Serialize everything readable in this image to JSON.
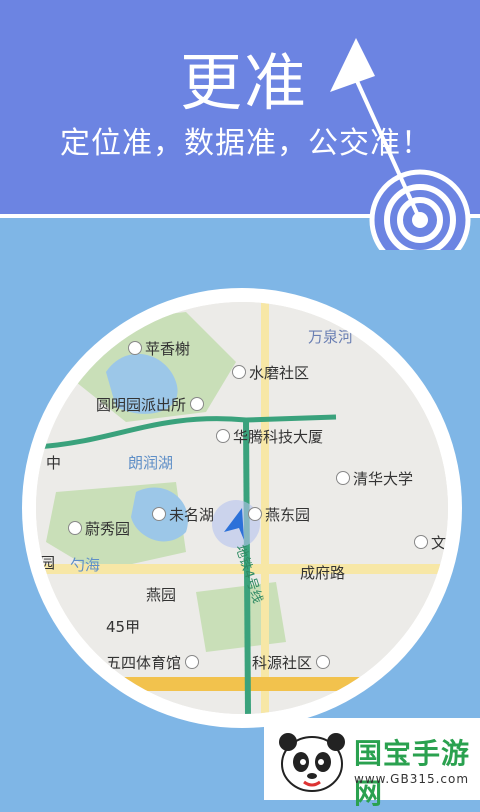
{
  "header": {
    "headline": "更准",
    "subline": "定位准，数据准，公交准！",
    "bg_color": "#6c84e2"
  },
  "main": {
    "bg_color": "#7fb6e6",
    "map": {
      "pois": [
        {
          "label": "苹香榭",
          "icon": "building-icon"
        },
        {
          "label": "万泉河",
          "icon": ""
        },
        {
          "label": "水磨社区",
          "icon": "building-icon"
        },
        {
          "label": "圆明园派出所",
          "icon": "police-icon"
        },
        {
          "label": "华腾科技大厦",
          "icon": "building-icon"
        },
        {
          "label": "中",
          "icon": ""
        },
        {
          "label": "朗润湖",
          "icon": ""
        },
        {
          "label": "清华大学",
          "icon": "school-icon"
        },
        {
          "label": "蔚秀园",
          "icon": "building-icon"
        },
        {
          "label": "未名湖",
          "icon": "building-icon"
        },
        {
          "label": "燕东园",
          "icon": "building-icon"
        },
        {
          "label": "园",
          "icon": ""
        },
        {
          "label": "勺海",
          "icon": ""
        },
        {
          "label": "成府路",
          "icon": ""
        },
        {
          "label": "燕园",
          "icon": ""
        },
        {
          "label": "45甲",
          "icon": ""
        },
        {
          "label": "五四体育馆",
          "icon": "sports-icon"
        },
        {
          "label": "科源社区",
          "icon": "building-icon"
        },
        {
          "label": "文",
          "icon": ""
        },
        {
          "label": "地铁4号线",
          "icon": ""
        }
      ],
      "location_marker": "location-arrow-icon"
    }
  },
  "watermark": {
    "brand": "国宝手游网",
    "url": "www.GB315.com"
  }
}
